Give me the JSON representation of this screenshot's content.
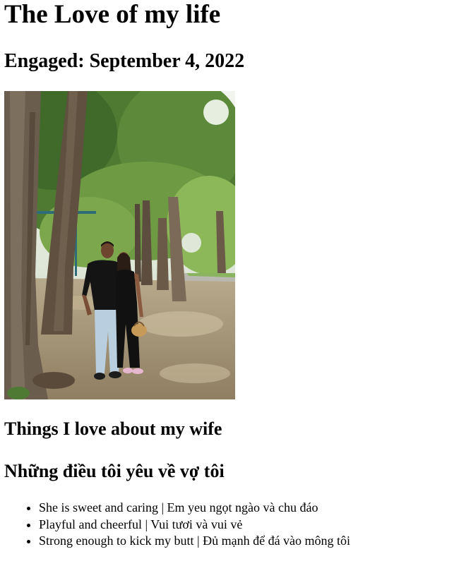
{
  "page": {
    "title": "The Love of my life",
    "engaged": "Engaged: September 4, 2022"
  },
  "photo": {
    "description_icon": "couple-photo",
    "colors": {
      "sky": "#e8efe6",
      "foliage_dark": "#3f6a2a",
      "foliage_light": "#8db85a",
      "trunk": "#6b5a48",
      "pavement": "#a89878",
      "shirt": "#141414",
      "jeans": "#b9cfe0",
      "skin": "#7a4e36"
    }
  },
  "section": {
    "heading_en": "Things I love about my wife",
    "heading_vi": "Những điều tôi yêu về vợ tôi"
  },
  "loves": [
    {
      "text": "She is sweet and caring | Em yeu ngọt ngào và chu đáo"
    },
    {
      "text": "Playful and cheerful | Vui tươi và vui vẻ"
    },
    {
      "text": "Strong enough to kick my butt | Đủ mạnh để đá vào mông tôi"
    }
  ]
}
